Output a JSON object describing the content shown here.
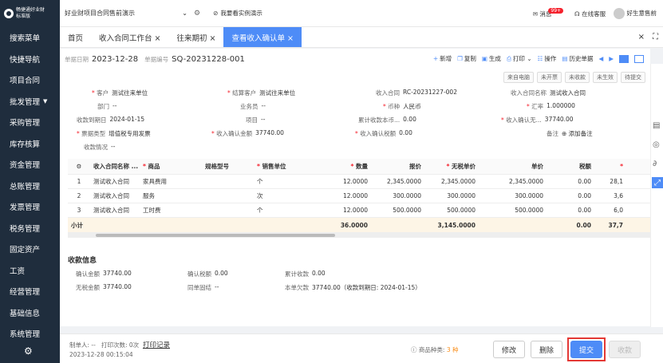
{
  "sidebar": {
    "logo_line1": "畅捷通好业财",
    "logo_line2": "标准版",
    "items": [
      "搜索菜单",
      "快捷导航",
      "项目合同",
      "批发管理",
      "采购管理",
      "库存核算",
      "资金管理",
      "总账管理",
      "发票管理",
      "税务管理",
      "固定资产",
      "工资",
      "经营管理",
      "基础信息",
      "系统管理"
    ]
  },
  "topbar": {
    "company": "好业财项目合同售前演示",
    "demo": "我要看实例演示",
    "messages": "消息",
    "msg_badge": "99+",
    "service": "在线客服",
    "user": "好生意售前"
  },
  "tabs": [
    {
      "label": "首页"
    },
    {
      "label": "收入合同工作台 ×"
    },
    {
      "label": "往来期初 ×"
    },
    {
      "label": "查看收入确认单 ×"
    }
  ],
  "header": {
    "date_label": "单据日期",
    "date": "2023-12-28",
    "no_label": "单据编号",
    "no": "SQ-20231228-001"
  },
  "toolbar": [
    "新增",
    "复制",
    "生成",
    "打印",
    "操作",
    "历史单据"
  ],
  "statuses": [
    "来自电脑",
    "未开票",
    "未收款",
    "未生效",
    "待提交"
  ],
  "fields": {
    "customer": {
      "label": "客户",
      "value": "测试往来单位"
    },
    "settle": {
      "label": "结算客户",
      "value": "测试往来单位"
    },
    "contract": {
      "label": "收入合同",
      "value": "RC-20231227-002"
    },
    "contract_name": {
      "label": "收入合同名称",
      "value": "测试收入合同"
    },
    "dept": {
      "label": "部门",
      "value": "--"
    },
    "staff": {
      "label": "业务员",
      "value": "--"
    },
    "currency": {
      "label": "币种",
      "value": "人民币"
    },
    "rate": {
      "label": "汇率",
      "value": "1.000000"
    },
    "due": {
      "label": "收款到期日",
      "value": "2024-01-15"
    },
    "project": {
      "label": "项目",
      "value": "--"
    },
    "acc": {
      "label": "累计收款本币...",
      "value": "0.00"
    },
    "confirm_no_tax": {
      "label": "收入确认无...",
      "value": "37740.00"
    },
    "invoice_type": {
      "label": "票据类型",
      "value": "增值税专用发票"
    },
    "confirm_amt": {
      "label": "收入确认金额",
      "value": "37740.00"
    },
    "confirm_tax": {
      "label": "收入确认税额",
      "value": "0.00"
    },
    "remark": {
      "label": "备注",
      "value": "添加备注"
    },
    "recv_status": {
      "label": "收款情况",
      "value": "--"
    }
  },
  "table": {
    "headers": [
      "收入合同名称 ...",
      "商品",
      "规格型号",
      "销售单位",
      "数量",
      "报价",
      "无税单价",
      "单价",
      "税额",
      "*"
    ],
    "rows": [
      [
        "1",
        "测试收入合同",
        "家具费用",
        "",
        "个",
        "12.0000",
        "2,345.0000",
        "2,345.0000",
        "2,345.0000",
        "0.00",
        "28,1"
      ],
      [
        "2",
        "测试收入合同",
        "服务",
        "",
        "次",
        "12.0000",
        "300.0000",
        "300.0000",
        "300.0000",
        "0.00",
        "3,6"
      ],
      [
        "3",
        "测试收入合同",
        "工时费",
        "",
        "个",
        "12.0000",
        "500.0000",
        "500.0000",
        "500.0000",
        "0.00",
        "6,0"
      ]
    ],
    "sum": {
      "label": "小计",
      "qty": "36.0000",
      "price": "3,145.0000",
      "tax": "0.00",
      "total": "37,7"
    }
  },
  "recv": {
    "title": "收款信息",
    "confirm_amt_label": "确认金额",
    "confirm_amt": "37740.00",
    "confirm_tax_label": "确认税额",
    "confirm_tax": "0.00",
    "acc_label": "累计收款",
    "acc": "0.00",
    "notax_label": "无税金额",
    "notax": "37740.00",
    "sync_label": "同单固结",
    "sync": "--",
    "owe_label": "本单欠款",
    "owe": "37740.00（收款到期日: 2024-01-15）"
  },
  "footer": {
    "maker": "制单人: --",
    "print_count": "打印次数: 0次",
    "print_record": "打印记录",
    "time": "2023-12-28 00:15:04",
    "kinds": "商品种类: ",
    "kinds_num": "3 种",
    "btn_edit": "修改",
    "btn_delete": "删除",
    "btn_submit": "提交",
    "btn_collect": "收款"
  }
}
